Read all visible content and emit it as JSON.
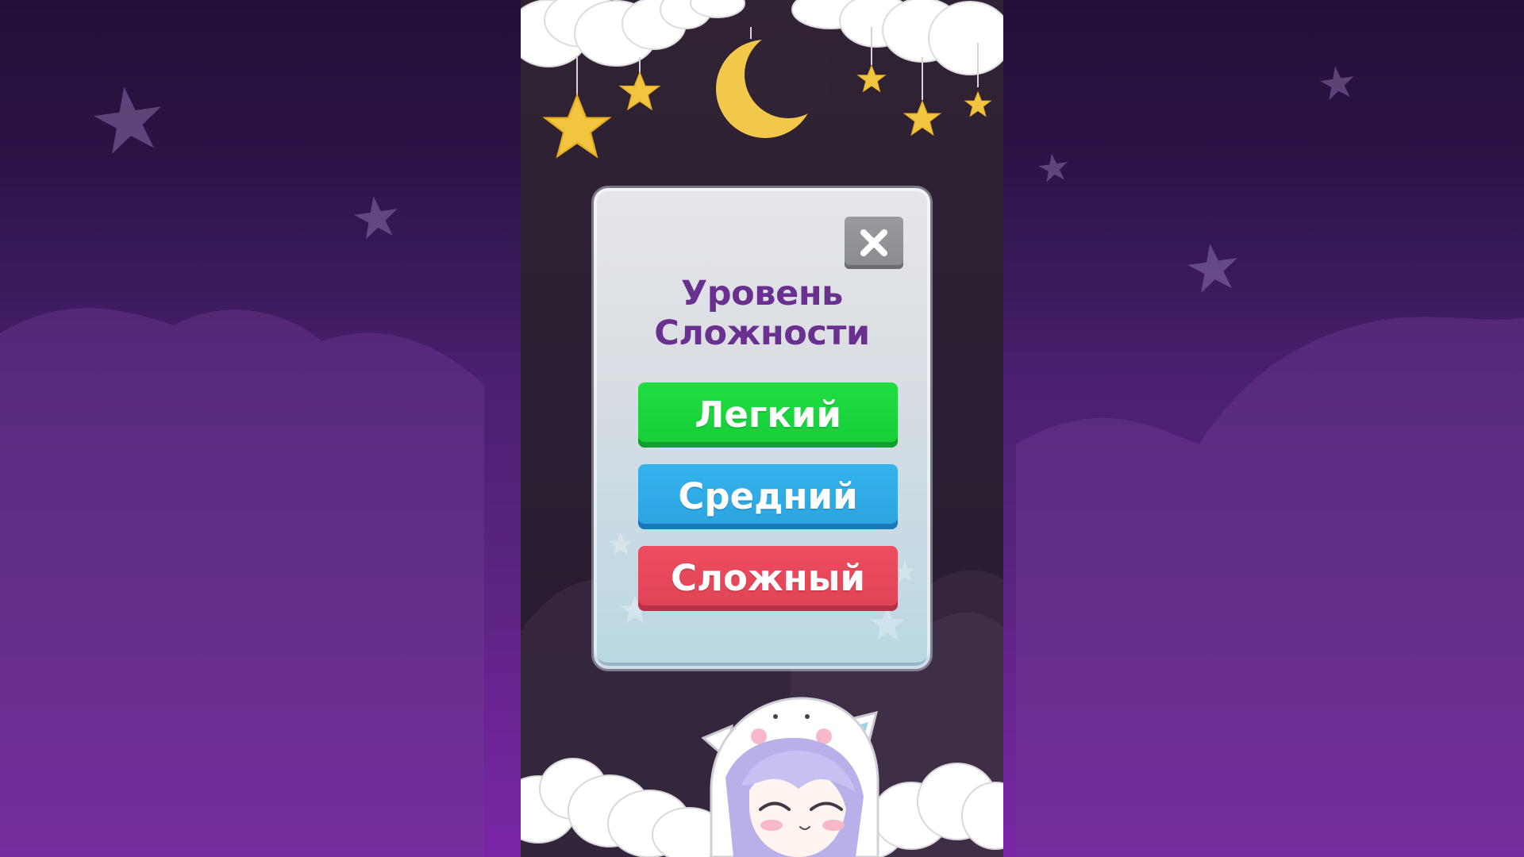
{
  "modal": {
    "title_line_1": "Уровень",
    "title_line_2": "Сложности",
    "buttons": {
      "easy": "Легкий",
      "medium": "Средний",
      "hard": "Сложный"
    }
  },
  "icons": {
    "close": "close-icon",
    "moon": "moon-icon",
    "star": "star-icon"
  },
  "colors": {
    "title": "#6A3090",
    "easy": "#1FDD41",
    "medium": "#34B3ED",
    "hard": "#EC4E5F",
    "close_button": "#9B9A9F",
    "moon": "#F1C84A",
    "star": "#F2C540"
  }
}
